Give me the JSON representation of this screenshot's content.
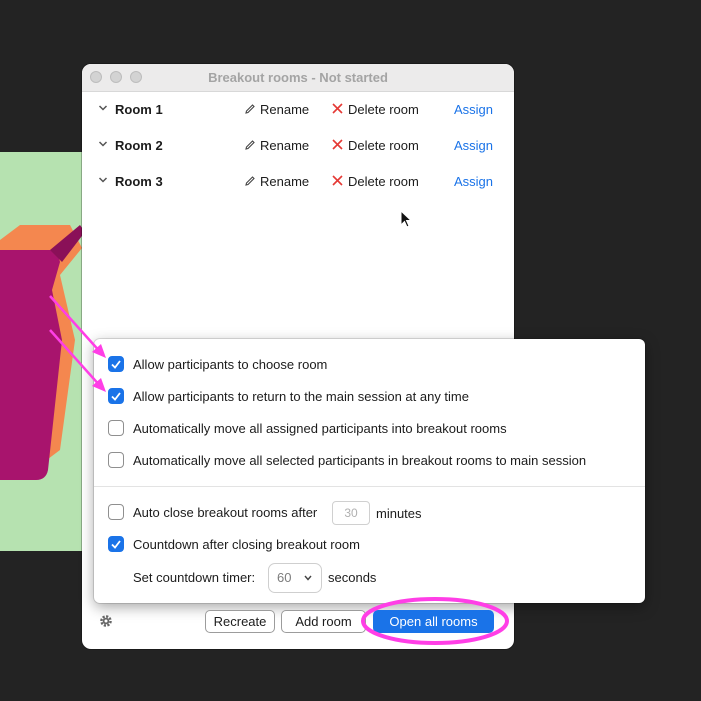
{
  "window": {
    "title": "Breakout rooms - Not started"
  },
  "rooms": [
    {
      "name": "Room 1",
      "rename": "Rename",
      "delete": "Delete room",
      "assign": "Assign"
    },
    {
      "name": "Room 2",
      "rename": "Rename",
      "delete": "Delete room",
      "assign": "Assign"
    },
    {
      "name": "Room 3",
      "rename": "Rename",
      "delete": "Delete room",
      "assign": "Assign"
    }
  ],
  "options": {
    "choose_room": {
      "label": "Allow participants to choose room",
      "checked": true
    },
    "return_main": {
      "label": "Allow participants to return to the main session at any time",
      "checked": true
    },
    "auto_move_assigned": {
      "label": "Automatically move all assigned participants into breakout rooms",
      "checked": false
    },
    "auto_move_selected": {
      "label": "Automatically move all selected participants in breakout rooms to main session",
      "checked": false
    },
    "auto_close": {
      "label": "Auto close breakout rooms after",
      "checked": false,
      "value": "30",
      "unit": "minutes"
    },
    "countdown": {
      "label": "Countdown after closing breakout room",
      "checked": true
    },
    "timer": {
      "label": "Set countdown timer:",
      "value": "60",
      "unit": "seconds"
    }
  },
  "buttons": {
    "recreate": "Recreate",
    "add_room": "Add room",
    "open_all": "Open all rooms"
  },
  "colors": {
    "accent": "#1a73e8",
    "delete": "#e53935",
    "annotation": "#ff3ee6",
    "background_art_green": "#b6e2b0"
  }
}
